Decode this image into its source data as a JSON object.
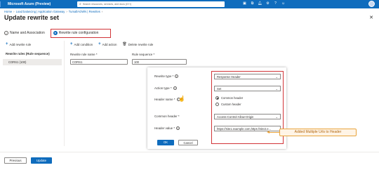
{
  "topbar": {
    "brand": "Microsoft Azure (Preview)",
    "search_placeholder": "Search resources, services, and docs (G+/)",
    "user_line1": "",
    "user_line2": ""
  },
  "breadcrumb": [
    "Home",
    "Load balancing | Application Gateway",
    "TumallAGWN | Rewrites",
    ""
  ],
  "page": {
    "title": "Update rewrite set",
    "close": "✕"
  },
  "tabs": [
    {
      "label": "Name and Association",
      "state": "done"
    },
    {
      "label": "Rewrite rule configuration",
      "state": "active"
    }
  ],
  "left": {
    "add_rule": "Add rewrite rule",
    "rules_header": "Rewrite rules (Rule sequence)",
    "rule_item": "CORS1 (100)"
  },
  "toolbar": {
    "add_condition": "Add condition",
    "add_action": "Add action",
    "delete_rule": "Delete rewrite rule"
  },
  "form": {
    "rule_name_label": "Rewrite rule name *",
    "rule_name_value": "CORS1",
    "rule_seq_label": "Rule sequence *",
    "rule_seq_value": "100"
  },
  "action_panel": {
    "rewrite_type_label": "Rewrite type *",
    "rewrite_type_value": "Response Header",
    "action_type_label": "Action type *",
    "action_type_value": "Set",
    "header_name_label": "Header name *",
    "radio_common": "Common header",
    "radio_custom": "Custom header",
    "common_header_label": "Common header *",
    "common_header_value": "Access-Control-Allow-Origin",
    "header_value_label": "Header value *",
    "header_value_value": "https://site1.example.com,https://site2.e...",
    "ok": "OK",
    "cancel": "Cancel"
  },
  "callout": "Added Multiple Urls to Header",
  "footer": {
    "previous": "Previous",
    "update": "Update"
  },
  "colors": {
    "accent": "#0f6cbd",
    "highlight": "#d13438",
    "callout": "#e8a33c"
  }
}
